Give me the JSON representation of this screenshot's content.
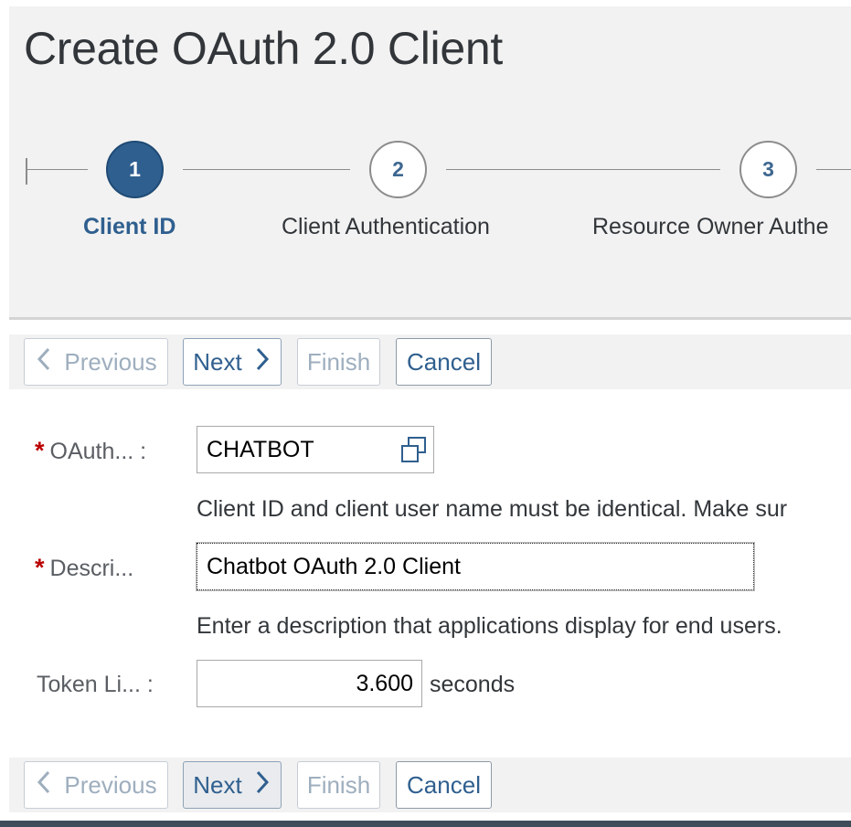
{
  "page": {
    "title": "Create OAuth 2.0 Client"
  },
  "roadmap": {
    "steps": [
      {
        "number": "1",
        "label": "Client ID",
        "state": "active"
      },
      {
        "number": "2",
        "label": "Client Authentication",
        "state": "inactive"
      },
      {
        "number": "3",
        "label": "Resource Owner Authe",
        "state": "inactive"
      }
    ]
  },
  "toolbar": {
    "previous_label": "Previous",
    "next_label": "Next",
    "finish_label": "Finish",
    "cancel_label": "Cancel",
    "previous_disabled": true,
    "finish_disabled": true
  },
  "form": {
    "client_id": {
      "label": "OAuth... :",
      "required": true,
      "value": "CHATBOT",
      "help": "Client ID and client user name must be identical. Make sur"
    },
    "description": {
      "label": "Descri...",
      "required": true,
      "value": "Chatbot OAuth 2.0 Client",
      "help": "Enter a description that applications display for end users."
    },
    "token_lifetime": {
      "label": "Token Li... :",
      "value": "3.600",
      "unit": "seconds"
    }
  },
  "colors": {
    "accent": "#2f5f8f",
    "required": "#bb0000",
    "header_bg": "#f2f2f2",
    "footer_bar": "#3f4c5a"
  },
  "icons": {
    "copy": "copy-icon",
    "chevron_left": "chevron-left-icon",
    "chevron_right": "chevron-right-icon"
  }
}
